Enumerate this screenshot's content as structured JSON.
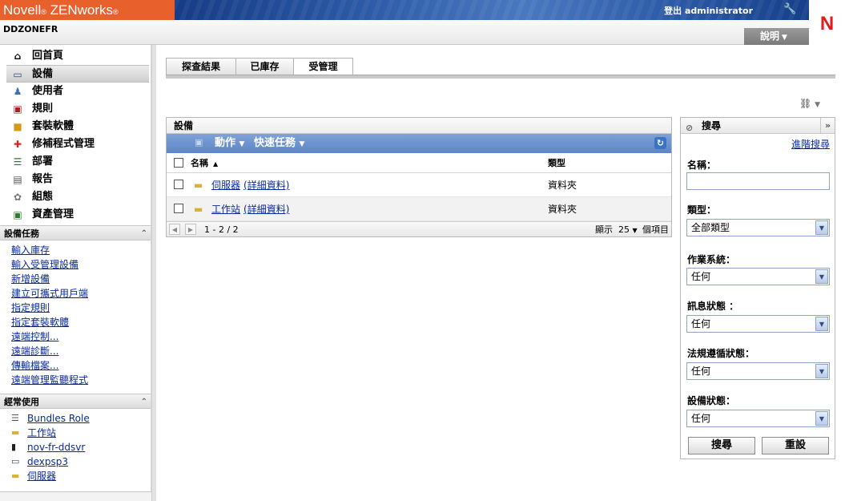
{
  "header": {
    "brand": "Novell",
    "brand_mark": "®",
    "product": "ZENworks",
    "product_mark": "®",
    "login": "登出 administrator",
    "zone": "DDZONEFR",
    "help": "說明"
  },
  "nav": {
    "items": [
      {
        "label": "回首頁",
        "icon": "home-icon"
      },
      {
        "label": "設備",
        "icon": "monitor-icon"
      },
      {
        "label": "使用者",
        "icon": "user-icon"
      },
      {
        "label": "規則",
        "icon": "policy-icon"
      },
      {
        "label": "套裝軟體",
        "icon": "bundle-icon"
      },
      {
        "label": "修補程式管理",
        "icon": "patch-icon"
      },
      {
        "label": "部署",
        "icon": "deploy-icon"
      },
      {
        "label": "報告",
        "icon": "report-icon"
      },
      {
        "label": "組態",
        "icon": "config-icon"
      },
      {
        "label": "資產管理",
        "icon": "asset-icon"
      }
    ]
  },
  "device_tasks": {
    "title": "設備任務",
    "links": [
      "輸入庫存",
      "輸入受管理設備",
      "新增設備",
      "建立可攜式用戶端",
      "指定規則",
      "指定套裝軟體",
      "遠端控制...",
      "遠端診斷...",
      "傳輸檔案...",
      "遠端管理監聽程式"
    ]
  },
  "frequently_used": {
    "title": "經常使用",
    "items": [
      {
        "label": "Bundles Role",
        "icon": "list-icon"
      },
      {
        "label": "工作站",
        "icon": "folder-icon"
      },
      {
        "label": "nov-fr-ddsvr",
        "icon": "server-icon"
      },
      {
        "label": "dexpsp3",
        "icon": "monitor-icon"
      },
      {
        "label": "伺服器",
        "icon": "folder-icon"
      }
    ]
  },
  "tabs": [
    "探查結果",
    "已庫存",
    "受管理"
  ],
  "devices": {
    "title": "設備",
    "actions": "動作",
    "quick_tasks": "快速任務",
    "col_name": "名稱",
    "col_type": "類型",
    "rows": [
      {
        "name": "伺服器",
        "detail": "(詳細資料)",
        "type": "資料夾"
      },
      {
        "name": "工作站",
        "detail": "(詳細資料)",
        "type": "資料夾"
      }
    ],
    "range": "1 - 2 / 2",
    "show": "顯示",
    "page_size": "25",
    "items_label": "個項目"
  },
  "search": {
    "title": "搜尋",
    "advanced": "進階搜尋",
    "name_label": "名稱：",
    "name_value": "",
    "type_label": "類型：",
    "type_value": "全部類型",
    "os_label": "作業系統：",
    "os_value": "任何",
    "msg_label": "訊息狀態 ：",
    "msg_value": "任何",
    "compliance_label": "法規遵循狀態：",
    "compliance_value": "任何",
    "device_status_label": "設備狀態：",
    "device_status_value": "任何",
    "search_btn": "搜尋",
    "reset_btn": "重設"
  }
}
